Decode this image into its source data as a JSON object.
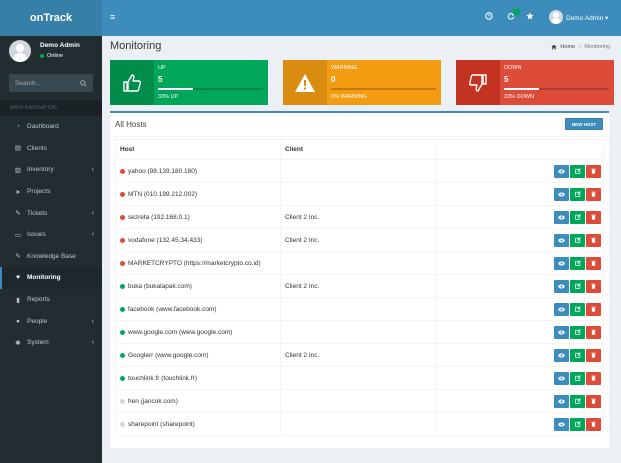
{
  "app": {
    "logo": "onTrack"
  },
  "user": {
    "name": "Demo Admin",
    "status": "Online",
    "menu_label": "Demo Admin"
  },
  "search": {
    "placeholder": "Search..."
  },
  "nav": {
    "header": "MAIN NAVIGATION",
    "items": [
      {
        "label": "Dashboard",
        "icon": "dashboard-icon",
        "chevron": false
      },
      {
        "label": "Clients",
        "icon": "clients-icon",
        "chevron": false
      },
      {
        "label": "Inventory",
        "icon": "inventory-icon",
        "chevron": true
      },
      {
        "label": "Projects",
        "icon": "projects-icon",
        "chevron": false
      },
      {
        "label": "Tickets",
        "icon": "tickets-icon",
        "chevron": true
      },
      {
        "label": "Issues",
        "icon": "issues-icon",
        "chevron": true
      },
      {
        "label": "Knowledge Base",
        "icon": "knowledge-base-icon",
        "chevron": false
      },
      {
        "label": "Monitoring",
        "icon": "monitoring-icon",
        "chevron": false,
        "active": true
      },
      {
        "label": "Reports",
        "icon": "reports-icon",
        "chevron": false
      },
      {
        "label": "People",
        "icon": "people-icon",
        "chevron": true
      },
      {
        "label": "System",
        "icon": "system-icon",
        "chevron": true
      }
    ]
  },
  "page": {
    "title": "Monitoring"
  },
  "breadcrumb": {
    "home": "Home",
    "separator": ">",
    "current": "Monitoring"
  },
  "stats": {
    "up": {
      "label": "UP",
      "value": "5",
      "sub": "33% UP",
      "progress": 0.33,
      "color": "#00a65a"
    },
    "warning": {
      "label": "WARNING",
      "value": "0",
      "sub": "0% WARNING",
      "progress": 0.0,
      "color": "#f39c12"
    },
    "down": {
      "label": "DOWN",
      "value": "5",
      "sub": "33% DOWN",
      "progress": 0.33,
      "color": "#dd4b39"
    }
  },
  "hosts_panel": {
    "title": "All Hosts",
    "new_button": "NEW HOST",
    "columns": [
      "Host",
      "Client",
      ""
    ],
    "rows": [
      {
        "host": "yahoo (98.139.180.180)",
        "client": "",
        "status": "down"
      },
      {
        "host": "MTN (010.199.212.002)",
        "client": "",
        "status": "down"
      },
      {
        "host": "sezreta (192.168.0.1)",
        "client": "Client 2 Inc.",
        "status": "down"
      },
      {
        "host": "vodafone (132.45.34.433)",
        "client": "Client 2 Inc.",
        "status": "down"
      },
      {
        "host": "MARKETCRYPTO (https://marketcrypto.co.id)",
        "client": "",
        "status": "down"
      },
      {
        "host": "buka (bukalapak.com)",
        "client": "Client 2 Inc.",
        "status": "up"
      },
      {
        "host": "facebook (www.facebook.com)",
        "client": "",
        "status": "up"
      },
      {
        "host": "www.google.com (www.google.com)",
        "client": "",
        "status": "up"
      },
      {
        "host": "Googlerr (www.google.com)",
        "client": "Client 2 Inc.",
        "status": "up"
      },
      {
        "host": "touchlink.fr (touchlink.fr)",
        "client": "",
        "status": "up"
      },
      {
        "host": "hen (jancok.com)",
        "client": "",
        "status": "unknown"
      },
      {
        "host": "sharepoint (sharepoint)",
        "client": "",
        "status": "unknown"
      }
    ]
  },
  "status_colors": {
    "up": "#00a65a",
    "down": "#dd4b39",
    "unknown": "#d2d6de"
  }
}
